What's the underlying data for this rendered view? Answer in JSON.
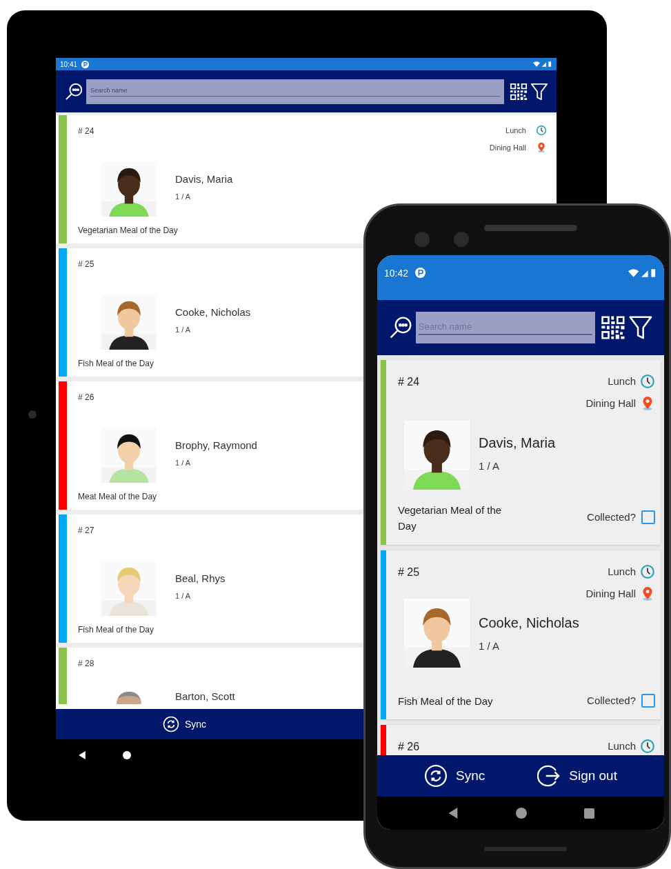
{
  "tablet": {
    "status_bar": {
      "time": "10:41"
    },
    "search": {
      "placeholder": "Search name"
    },
    "students": [
      {
        "number": "# 24",
        "name": "Davis, Maria",
        "class": "1 / A",
        "meal": "Vegetarian Meal of the Day",
        "color": "#8bc34a",
        "service": "Lunch",
        "location": "Dining Hall"
      },
      {
        "number": "# 25",
        "name": "Cooke, Nicholas",
        "class": "1 / A",
        "meal": "Fish Meal of the Day",
        "color": "#03a9f4"
      },
      {
        "number": "# 26",
        "name": "Brophy, Raymond",
        "class": "1 / A",
        "meal": "Meat Meal of the Day",
        "color": "#ff0000"
      },
      {
        "number": "# 27",
        "name": "Beal, Rhys",
        "class": "1 / A",
        "meal": "Fish Meal of the Day",
        "color": "#03a9f4"
      },
      {
        "number": "# 28",
        "name": "Barton, Scott",
        "color": "#8bc34a"
      }
    ],
    "bottom_bar": {
      "buttons": [
        "Sync"
      ]
    }
  },
  "phone": {
    "status_bar": {
      "time": "10:42"
    },
    "search": {
      "placeholder": "Search name"
    },
    "students": [
      {
        "number": "# 24",
        "name": "Davis, Maria",
        "class": "1 / A",
        "meal": "Vegetarian Meal of the Day",
        "color": "#8bc34a",
        "service": "Lunch",
        "location": "Dining Hall",
        "collected_label": "Collected?",
        "collected": false
      },
      {
        "number": "# 25",
        "name": "Cooke, Nicholas",
        "class": "1 / A",
        "meal": "Fish Meal of the Day",
        "color": "#03a9f4",
        "service": "Lunch",
        "location": "Dining Hall",
        "collected_label": "Collected?",
        "collected": false
      },
      {
        "number": "# 26",
        "color": "#ff0000",
        "service": "Lunch"
      }
    ],
    "bottom_bar": {
      "buttons": [
        "Sync",
        "Sign out"
      ]
    }
  }
}
